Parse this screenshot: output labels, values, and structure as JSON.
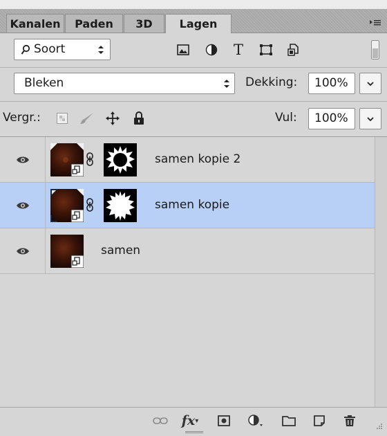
{
  "tabs": [
    {
      "label": "Kanalen",
      "active": false
    },
    {
      "label": "Paden",
      "active": false
    },
    {
      "label": "3D",
      "active": false
    },
    {
      "label": "Lagen",
      "active": true
    }
  ],
  "filter": {
    "kind_label": "Soort",
    "kind_icon": "search-icon",
    "filter_icons": [
      "image-filter-icon",
      "adjustment-filter-icon",
      "type-filter-icon",
      "shape-filter-icon",
      "smart-object-filter-icon"
    ]
  },
  "blend": {
    "mode": "Bleken",
    "opacity_label": "Dekking:",
    "opacity_value": "100%"
  },
  "lock": {
    "label": "Vergr.:",
    "fill_label": "Vul:",
    "fill_value": "100%"
  },
  "layers": [
    {
      "name": "samen kopie 2",
      "visible": true,
      "selected": false,
      "has_mask": true
    },
    {
      "name": "samen kopie",
      "visible": true,
      "selected": true,
      "has_mask": true
    },
    {
      "name": "samen",
      "visible": true,
      "selected": false,
      "has_mask": false
    }
  ],
  "colors": {
    "panel": "#d6d6d6",
    "selected_row": "#b8cff6",
    "tab_bar": "#a9a9a9"
  },
  "bottom_icons": [
    "link-layers-icon",
    "fx-icon",
    "add-mask-icon",
    "adjustment-layer-icon",
    "new-group-icon",
    "new-layer-icon",
    "delete-layer-icon"
  ]
}
